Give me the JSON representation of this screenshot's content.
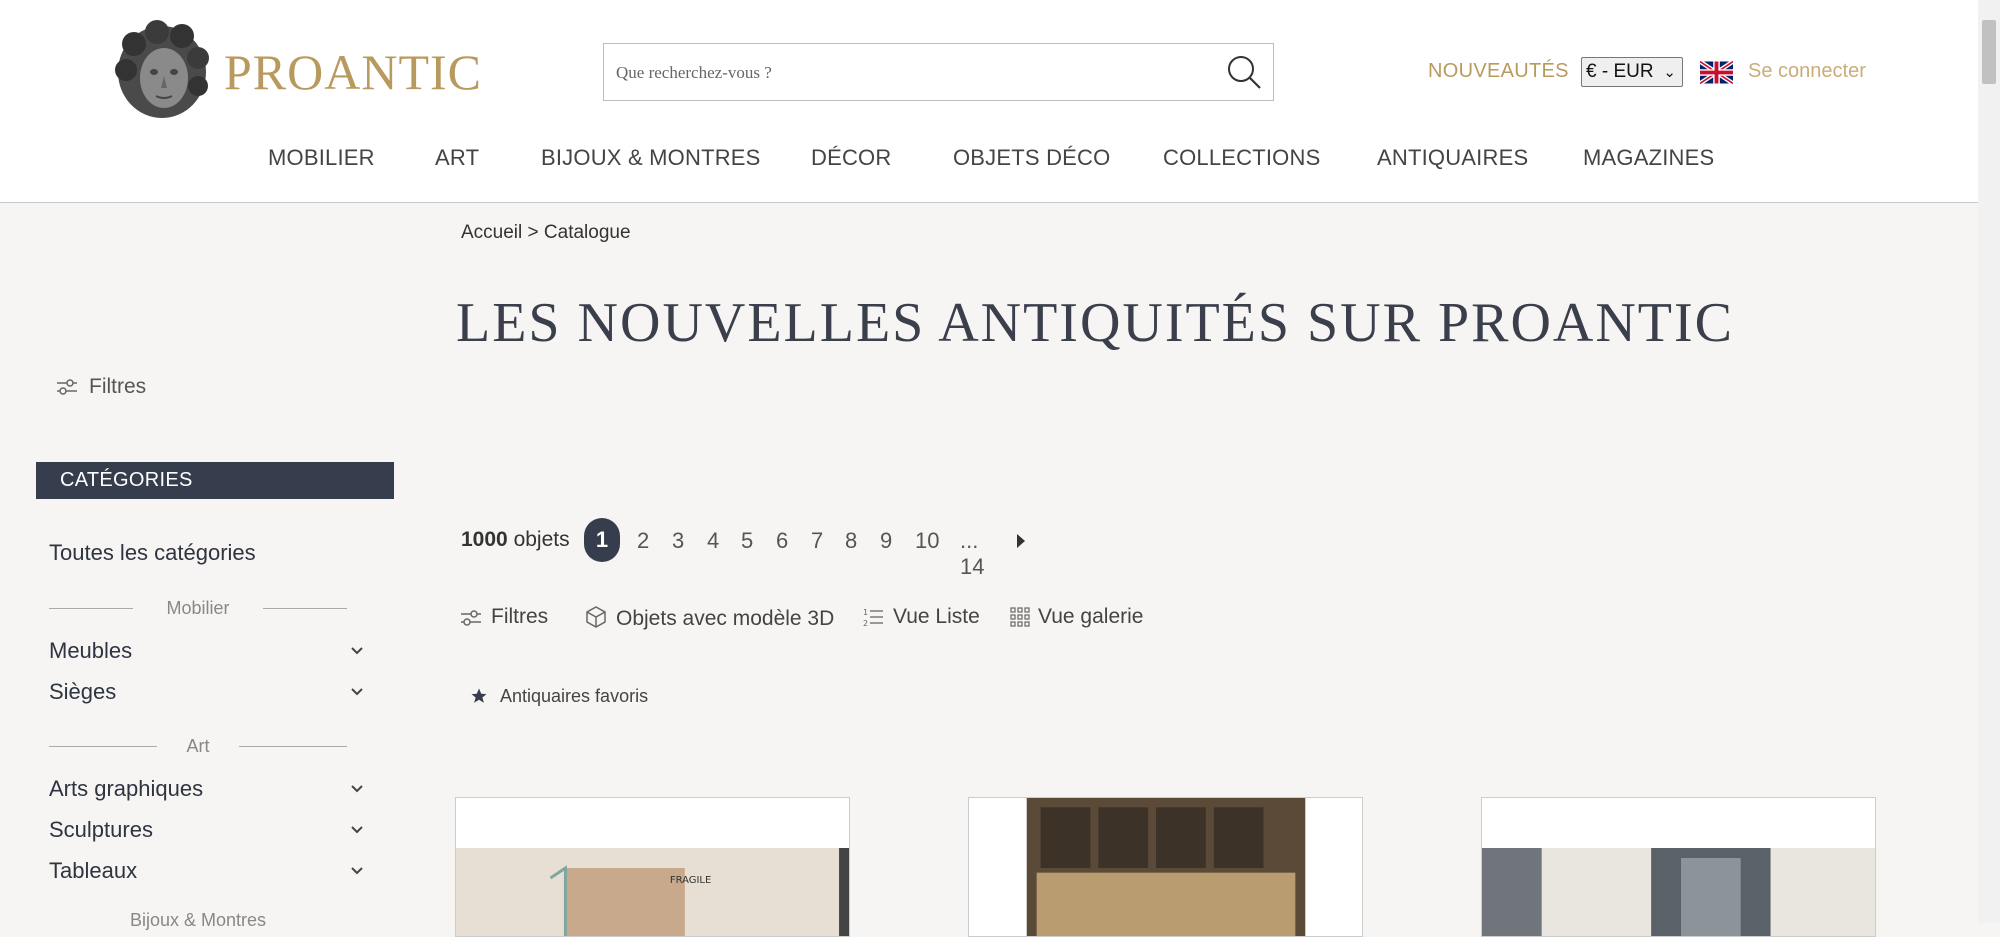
{
  "header": {
    "logo_text": "PROANTIC",
    "search_placeholder": "Que recherchez-vous ?",
    "nouveautes": "NOUVEAUTÉS",
    "currency": "€ - EUR",
    "login": "Se connecter"
  },
  "nav": [
    "MOBILIER",
    "ART",
    "BIJOUX & MONTRES",
    "DÉCOR",
    "OBJETS DÉCO",
    "COLLECTIONS",
    "ANTIQUAIRES",
    "MAGAZINES"
  ],
  "sidebar": {
    "filters": "Filtres",
    "categories_header": "CATÉGORIES",
    "all_categories": "Toutes les catégories",
    "sections": [
      {
        "label": "Mobilier",
        "items": [
          "Meubles",
          "Sièges"
        ]
      },
      {
        "label": "Art",
        "items": [
          "Arts graphiques",
          "Sculptures",
          "Tableaux"
        ]
      },
      {
        "label": "Bijoux & Montres",
        "items": []
      }
    ]
  },
  "main": {
    "breadcrumb": "Accueil > Catalogue",
    "title": "LES NOUVELLES ANTIQUITÉS SUR PROANTIC",
    "count_number": "1000",
    "count_label": "objets",
    "pages": [
      "1",
      "2",
      "3",
      "4",
      "5",
      "6",
      "7",
      "8",
      "9",
      "10",
      "... 14"
    ],
    "active_page": "1",
    "toolbar": {
      "filters": "Filtres",
      "objects_3d": "Objets avec modèle 3D",
      "list_view": "Vue Liste",
      "gallery_view": "Vue galerie"
    },
    "favorite_dealers": "Antiquaires favoris"
  },
  "colors": {
    "gold": "#b99a5e",
    "dark": "#363e4d",
    "background": "#f6f5f3"
  }
}
